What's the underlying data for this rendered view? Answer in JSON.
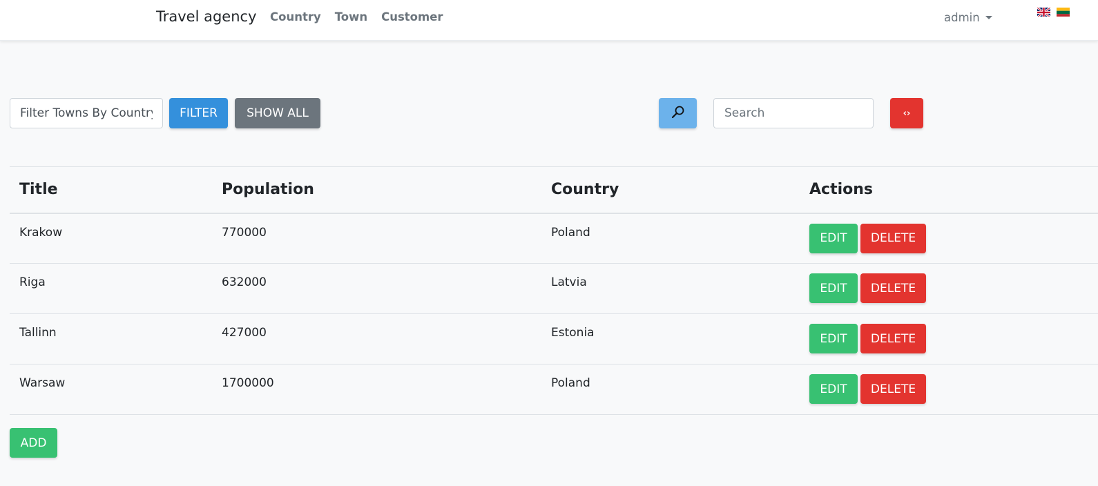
{
  "navbar": {
    "brand": "Travel agency",
    "links": [
      "Country",
      "Town",
      "Customer"
    ],
    "user": "admin",
    "flags": [
      "flag-gb-icon",
      "flag-lt-icon"
    ]
  },
  "filter": {
    "placeholder": "Filter Towns By Country",
    "filter_label": "FILTER",
    "show_all_label": "SHOW ALL"
  },
  "search": {
    "button_icon": "search-icon",
    "placeholder": "Search",
    "reset_icon": "reset-icon",
    "reset_glyph": "‹›"
  },
  "table": {
    "headers": [
      "Title",
      "Population",
      "Country",
      "Actions"
    ],
    "rows": [
      {
        "title": "Krakow",
        "population": "770000",
        "country": "Poland"
      },
      {
        "title": "Riga",
        "population": "632000",
        "country": "Latvia"
      },
      {
        "title": "Tallinn",
        "population": "427000",
        "country": "Estonia"
      },
      {
        "title": "Warsaw",
        "population": "1700000",
        "country": "Poland"
      }
    ],
    "edit_label": "EDIT",
    "delete_label": "DELETE"
  },
  "add_label": "ADD",
  "colors": {
    "primary": "#3490dc",
    "secondary": "#6c757d",
    "info": "#6cb2eb",
    "success": "#38c172",
    "danger": "#e3342f"
  }
}
